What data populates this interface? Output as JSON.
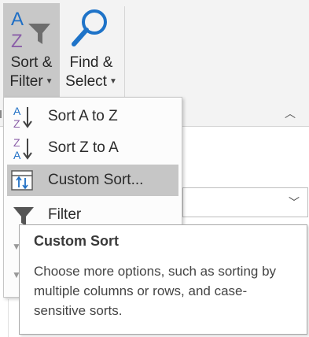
{
  "ribbon": {
    "sort_filter": {
      "line1": "Sort &",
      "line2": "Filter",
      "icon": "sort-filter-icon"
    },
    "find_select": {
      "line1": "Find &",
      "line2": "Select",
      "icon": "magnifier-icon"
    }
  },
  "menu": {
    "items": [
      {
        "label": "Sort A to Z",
        "icon": "sort-a-to-z-icon",
        "state": "enabled"
      },
      {
        "label": "Sort Z to A",
        "icon": "sort-z-to-a-icon",
        "state": "enabled"
      },
      {
        "label": "Custom Sort...",
        "icon": "custom-sort-icon",
        "state": "hovered"
      },
      {
        "label": "Filter",
        "icon": "filter-icon",
        "state": "enabled"
      }
    ]
  },
  "tooltip": {
    "title": "Custom Sort",
    "body": "Choose more options, such as sorting by multiple columns or rows, and case-sensitive sorts."
  },
  "colors": {
    "sort_letter_blue": "#1f6fc5",
    "sort_letter_purple": "#8b5fa8",
    "search_blue": "#1e73c8",
    "hover_gray": "#c6c6c6"
  }
}
